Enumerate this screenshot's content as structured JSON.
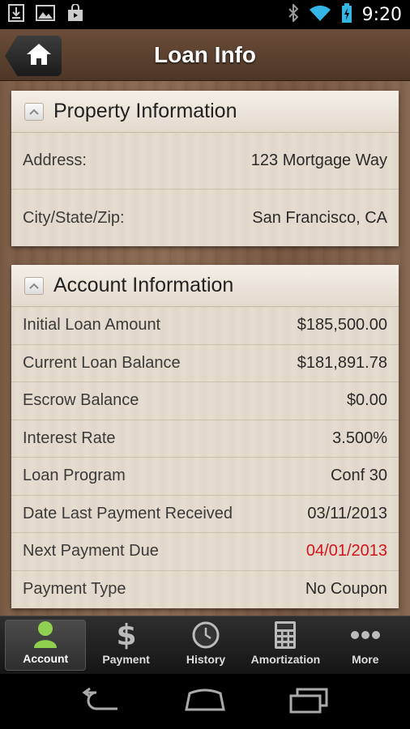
{
  "status_bar": {
    "time": "9:20",
    "left_icons": [
      "download-icon",
      "image-icon",
      "shop-bag-icon"
    ],
    "right_icons": [
      "bluetooth-icon",
      "wifi-icon",
      "battery-icon"
    ]
  },
  "header": {
    "title": "Loan Info",
    "home_icon": "home-icon"
  },
  "property_panel": {
    "title": "Property Information",
    "rows": [
      {
        "label": "Address:",
        "value": "123 Mortgage Way"
      },
      {
        "label": "City/State/Zip:",
        "value": "San Francisco, CA"
      }
    ]
  },
  "account_panel": {
    "title": "Account Information",
    "rows": [
      {
        "label": "Initial Loan Amount",
        "value": "$185,500.00"
      },
      {
        "label": "Current Loan Balance",
        "value": "$181,891.78"
      },
      {
        "label": "Escrow Balance",
        "value": "$0.00"
      },
      {
        "label": "Interest Rate",
        "value": "3.500%"
      },
      {
        "label": "Loan Program",
        "value": "Conf 30"
      },
      {
        "label": "Date Last Payment Received",
        "value": "03/11/2013"
      },
      {
        "label": "Next Payment Due",
        "value": "04/01/2013"
      },
      {
        "label": "Payment Type",
        "value": "No Coupon"
      }
    ]
  },
  "tabs": [
    {
      "label": "Account",
      "icon": "person-icon",
      "active": true
    },
    {
      "label": "Payment",
      "icon": "dollar-icon",
      "active": false
    },
    {
      "label": "History",
      "icon": "clock-icon",
      "active": false
    },
    {
      "label": "Amortization",
      "icon": "calculator-icon",
      "active": false
    },
    {
      "label": "More",
      "icon": "more-icon",
      "active": false
    }
  ],
  "colors": {
    "alert_red": "#d4141b",
    "active_tab_green": "#8fd14f"
  }
}
